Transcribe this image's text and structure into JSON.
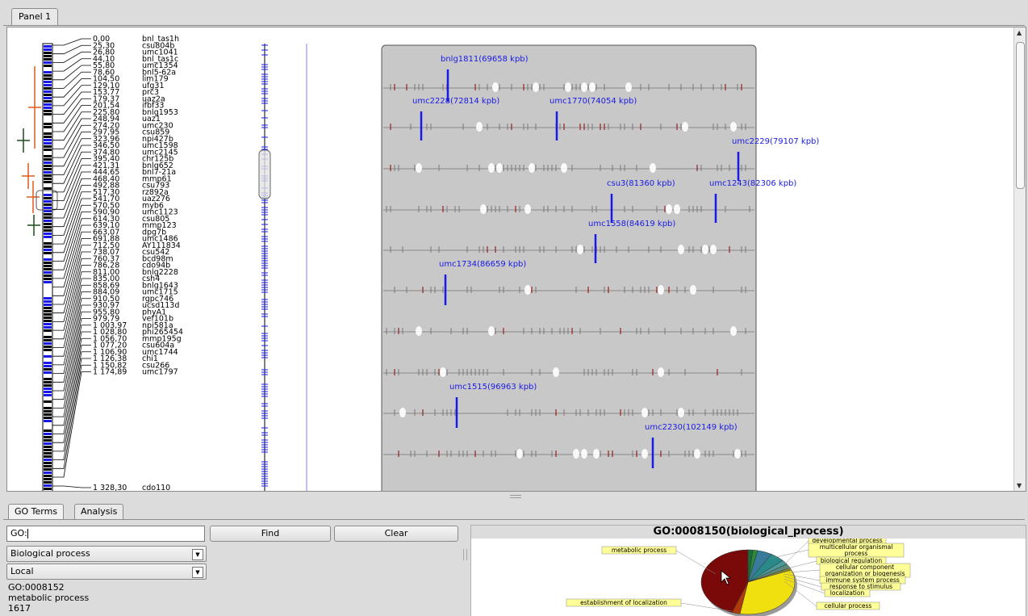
{
  "top_tab": {
    "label": "Panel 1"
  },
  "markers": [
    {
      "pos": "0,00",
      "name": "bnl_tas1h"
    },
    {
      "pos": "25,30",
      "name": "csu804b"
    },
    {
      "pos": "26,80",
      "name": "umc1041"
    },
    {
      "pos": "44,10",
      "name": "bnl_tas1c"
    },
    {
      "pos": "55,80",
      "name": "umc1354"
    },
    {
      "pos": "78,60",
      "name": "bnl5-62a"
    },
    {
      "pos": "104,50",
      "name": "lim179"
    },
    {
      "pos": "129,10",
      "name": "ufg31"
    },
    {
      "pos": "153,77",
      "name": "prc3"
    },
    {
      "pos": "179,37",
      "name": "uaz2a"
    },
    {
      "pos": "201,54",
      "name": "ifbf33"
    },
    {
      "pos": "225,80",
      "name": "bnlg1953"
    },
    {
      "pos": "248,94",
      "name": "uaz1"
    },
    {
      "pos": "274,20",
      "name": "umc230"
    },
    {
      "pos": "297,95",
      "name": "csu859"
    },
    {
      "pos": "323,96",
      "name": "npi427b"
    },
    {
      "pos": "346,50",
      "name": "umc1598"
    },
    {
      "pos": "374,80",
      "name": "umc2145"
    },
    {
      "pos": "395,40",
      "name": "chr125b"
    },
    {
      "pos": "421,31",
      "name": "bnlg652"
    },
    {
      "pos": "444,65",
      "name": "bnl7-21a"
    },
    {
      "pos": "468,40",
      "name": "mmp61"
    },
    {
      "pos": "492,88",
      "name": "csu793"
    },
    {
      "pos": "517,30",
      "name": "rz892a"
    },
    {
      "pos": "541,70",
      "name": "uaz276"
    },
    {
      "pos": "570,50",
      "name": "myb6"
    },
    {
      "pos": "590,90",
      "name": "umc1123"
    },
    {
      "pos": "614,30",
      "name": "csu805"
    },
    {
      "pos": "639,10",
      "name": "mmp123"
    },
    {
      "pos": "663,07",
      "name": "dpg7b"
    },
    {
      "pos": "691,88",
      "name": "umc1486"
    },
    {
      "pos": "712,50",
      "name": "AY111834"
    },
    {
      "pos": "738,07",
      "name": "csu542"
    },
    {
      "pos": "760,37",
      "name": "bcd98m"
    },
    {
      "pos": "786,28",
      "name": "cdo94b"
    },
    {
      "pos": "811,00",
      "name": "bnlg2228"
    },
    {
      "pos": "835,00",
      "name": "csh4"
    },
    {
      "pos": "858,69",
      "name": "bnlg1643"
    },
    {
      "pos": "884,09",
      "name": "umc1715"
    },
    {
      "pos": "910,50",
      "name": "rgpc746"
    },
    {
      "pos": "930,97",
      "name": "ucsd113d"
    },
    {
      "pos": "955,80",
      "name": "phyA1"
    },
    {
      "pos": "979,79",
      "name": "vef101b"
    },
    {
      "pos": "1 003,97",
      "name": "npi581a"
    },
    {
      "pos": "1 028,80",
      "name": "phi265454"
    },
    {
      "pos": "1 056,70",
      "name": "mmp195g"
    },
    {
      "pos": "1 077,20",
      "name": "csu604a"
    },
    {
      "pos": "1 106,90",
      "name": "umc1744"
    },
    {
      "pos": "1 126,38",
      "name": "chi1"
    },
    {
      "pos": "1 150,82",
      "name": "csu266"
    },
    {
      "pos": "1 174,89",
      "name": "umc1797"
    },
    {
      "pos": "1 328,30",
      "name": "cdo110"
    }
  ],
  "physical_labels": [
    {
      "text": "bnlg1811(69658 kpb)",
      "row": 0
    },
    {
      "text": "umc2228(72814 kpb)",
      "row": 1
    },
    {
      "text": "umc1770(74054 kpb)",
      "row": 1
    },
    {
      "text": "umc2229(79107 kpb)",
      "row": 2
    },
    {
      "text": "csu3(81360 kpb)",
      "row": 3
    },
    {
      "text": "umc1243(82306 kpb)",
      "row": 3
    },
    {
      "text": "umc1558(84619 kpb)",
      "row": 4
    },
    {
      "text": "umc1734(86659 kpb)",
      "row": 5
    },
    {
      "text": "umc1515(96963 kpb)",
      "row": 8
    },
    {
      "text": "umc2230(102149 kpb)",
      "row": 9
    }
  ],
  "bottom_tabs": [
    {
      "label": "GO Terms"
    },
    {
      "label": "Analysis"
    }
  ],
  "go_search": {
    "value": "GO:"
  },
  "buttons": {
    "find": "Find",
    "clear": "Clear"
  },
  "ontology_select": {
    "value": "Biological process"
  },
  "source_select": {
    "value": "Local"
  },
  "selected_term": {
    "id": "GO:0008152",
    "name": "metabolic process",
    "count": "1617"
  },
  "go_chart": {
    "title": "GO:0008150(biological_process)"
  },
  "chart_data": {
    "type": "pie",
    "title": "GO:0008150(biological_process)",
    "slices": [
      {
        "label": "metabolic process",
        "color": "#7a0a0a"
      },
      {
        "label": "developmental process",
        "color": "#1a6b3a"
      },
      {
        "label": "multicellular organismal process",
        "color": "#2a8a3a"
      },
      {
        "label": "biological regulation",
        "color": "#3a7a9a"
      },
      {
        "label": "cellular component organization or biogenesis",
        "color": "#2a8a8a"
      },
      {
        "label": "immune system process",
        "color": "#4a9a9a"
      },
      {
        "label": "response to stimulus",
        "color": "#5a8a7a"
      },
      {
        "label": "localization",
        "color": "#8a8a3a"
      },
      {
        "label": "cellular process",
        "color": "#f0e010"
      },
      {
        "label": "establishment of localization",
        "color": "#b03a0a"
      }
    ]
  }
}
